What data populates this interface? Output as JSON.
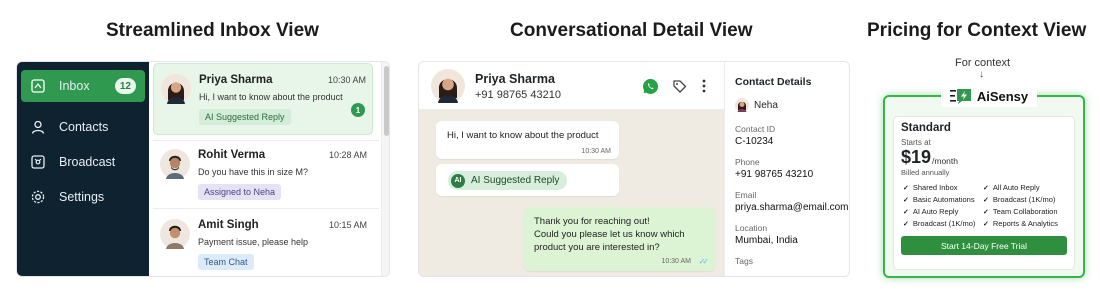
{
  "titles": {
    "inbox": "Streamlined Inbox View",
    "detail": "Conversational Detail View",
    "pricing": "Pricing for Context View"
  },
  "inbox": {
    "nav": [
      {
        "label": "Inbox",
        "icon": "inbox-icon",
        "badge": "12"
      },
      {
        "label": "Contacts",
        "icon": "user-icon"
      },
      {
        "label": "Broadcast",
        "icon": "broadcast-icon"
      },
      {
        "label": "Settings",
        "icon": "gear-icon"
      }
    ],
    "conversations": [
      {
        "name": "Priya Sharma",
        "time": "10:30 AM",
        "message": "Hi, I want to know about the product",
        "tag": "AI Suggested Reply",
        "unread": "1"
      },
      {
        "name": "Rohit Verma",
        "time": "10:28 AM",
        "message": "Do you have this in size M?",
        "tag": "Assigned to Neha"
      },
      {
        "name": "Amit Singh",
        "time": "10:15 AM",
        "message": "Payment issue, please help",
        "tag": "Team Chat"
      }
    ]
  },
  "detail": {
    "header": {
      "name": "Priya Sharma",
      "phone": "+91 98765 43210"
    },
    "messages": {
      "incoming": {
        "text": "Hi, I want to know about the product",
        "time": "10:30 AM"
      },
      "ai_label": "AI Suggested Reply",
      "ai_badge": "AI",
      "outgoing": {
        "lines": [
          "Thank you for reaching out!",
          "Could you please let us know which",
          "product you are interested in?"
        ],
        "time": "10:30 AM"
      }
    },
    "contact": {
      "title": "Contact Details",
      "name": "Neha",
      "fields": [
        {
          "label": "Contact ID",
          "value": "C-10234"
        },
        {
          "label": "Phone",
          "value": "+91 98765 43210"
        },
        {
          "label": "Email",
          "value": "priya.sharma@email.com"
        },
        {
          "label": "Location",
          "value": "Mumbai, India"
        },
        {
          "label": "Tags",
          "value": ""
        }
      ]
    }
  },
  "pricing": {
    "context_label": "For context",
    "arrow": "↓",
    "brand": "AiSensy",
    "plan": "Standard",
    "starts_at": "Starts at",
    "price": "$19",
    "per": "/month",
    "billed": "Billed annually",
    "features": [
      "Shared Inbox",
      "All Auto Reply",
      "Basic Automations",
      "Broadcast (1K/mo)",
      "AI Auto Reply",
      "Team Collaboration",
      "Broadcast (1K/mo)",
      "Reports & Analytics"
    ],
    "cta": "Start 14-Day Free Trial"
  },
  "colors": {
    "accent": "#2f9a4f",
    "sidebar": "#0f2230",
    "chat_bg": "#efeae2"
  }
}
